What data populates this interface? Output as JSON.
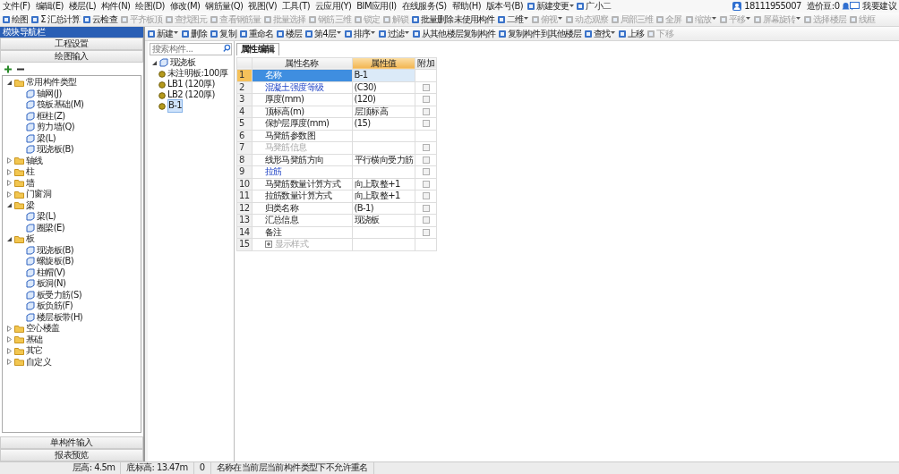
{
  "menu_bar": {
    "items": [
      "文件(F)",
      "编辑(E)",
      "楼层(L)",
      "构件(N)",
      "绘图(D)",
      "修改(M)",
      "钢筋量(Q)",
      "视图(V)",
      "工具(T)",
      "云应用(Y)",
      "BIM应用(I)",
      "在线服务(S)",
      "帮助(H)",
      "版本号(B)"
    ],
    "extras": [
      {
        "label": "新建变更",
        "dropdown": true
      },
      {
        "label": "广小二",
        "dropdown": false
      }
    ],
    "account": "18111955007",
    "beans": "造价豆:0",
    "feedback": "我要建议"
  },
  "main_toolbar": [
    {
      "label": "绘图",
      "disabled": false,
      "dropdown": false
    },
    {
      "label": "Σ 汇总计算",
      "disabled": false,
      "dropdown": false
    },
    {
      "label": "云检查",
      "disabled": false,
      "dropdown": false
    },
    {
      "label": "平齐板顶",
      "disabled": true,
      "dropdown": false
    },
    {
      "label": "查找图元",
      "disabled": true,
      "dropdown": false
    },
    {
      "label": "查看钢筋量",
      "disabled": true,
      "dropdown": false
    },
    {
      "label": "批量选择",
      "disabled": true,
      "dropdown": false
    },
    {
      "label": "钢筋三维",
      "disabled": true,
      "dropdown": false
    },
    {
      "label": "锁定",
      "disabled": true,
      "dropdown": false
    },
    {
      "label": "解锁",
      "disabled": true,
      "dropdown": false
    },
    {
      "label": "批量删除未使用构件",
      "disabled": false,
      "dropdown": false
    },
    {
      "label": "二维",
      "disabled": false,
      "dropdown": true
    },
    {
      "label": "俯视",
      "disabled": true,
      "dropdown": true
    },
    {
      "label": "动态观察",
      "disabled": true,
      "dropdown": false
    },
    {
      "label": "局部三维",
      "disabled": true,
      "dropdown": false
    },
    {
      "label": "全屏",
      "disabled": true,
      "dropdown": false
    },
    {
      "label": "缩放",
      "disabled": true,
      "dropdown": true
    },
    {
      "label": "平移",
      "disabled": true,
      "dropdown": true
    },
    {
      "label": "屏幕旋转",
      "disabled": true,
      "dropdown": true
    },
    {
      "label": "选择楼层",
      "disabled": true,
      "dropdown": false
    },
    {
      "label": "线框",
      "disabled": true,
      "dropdown": false
    }
  ],
  "navigator": {
    "title": "模块导航栏",
    "sections": [
      "工程设置",
      "绘图输入"
    ],
    "tree": [
      {
        "label": "常用构件类型",
        "expanded": true,
        "children": [
          {
            "label": "轴网(J)"
          },
          {
            "label": "筏板基础(M)"
          },
          {
            "label": "框柱(Z)"
          },
          {
            "label": "剪力墙(Q)"
          },
          {
            "label": "梁(L)"
          },
          {
            "label": "现浇板(B)"
          }
        ]
      },
      {
        "label": "轴线",
        "expanded": false
      },
      {
        "label": "柱",
        "expanded": false
      },
      {
        "label": "墙",
        "expanded": false
      },
      {
        "label": "门窗洞",
        "expanded": false
      },
      {
        "label": "梁",
        "expanded": true,
        "children": [
          {
            "label": "梁(L)"
          },
          {
            "label": "圈梁(E)"
          }
        ]
      },
      {
        "label": "板",
        "expanded": true,
        "children": [
          {
            "label": "现浇板(B)"
          },
          {
            "label": "螺旋板(B)"
          },
          {
            "label": "柱帽(V)"
          },
          {
            "label": "板洞(N)"
          },
          {
            "label": "板受力筋(S)"
          },
          {
            "label": "板负筋(F)"
          },
          {
            "label": "楼层板带(H)"
          }
        ]
      },
      {
        "label": "空心楼盖",
        "expanded": false
      },
      {
        "label": "基础",
        "expanded": false
      },
      {
        "label": "其它",
        "expanded": false
      },
      {
        "label": "自定义",
        "expanded": false
      }
    ],
    "bottom_sections": [
      "单构件输入",
      "报表预览"
    ]
  },
  "component_toolbar": [
    {
      "label": "新建",
      "disabled": false,
      "dropdown": true
    },
    {
      "label": "删除",
      "disabled": false,
      "dropdown": false
    },
    {
      "label": "复制",
      "disabled": false,
      "dropdown": false
    },
    {
      "label": "重命名",
      "disabled": false,
      "dropdown": false
    },
    {
      "label": "楼层",
      "disabled": false,
      "dropdown": false
    },
    {
      "label": "第4层",
      "disabled": false,
      "dropdown": true
    },
    {
      "label": "排序",
      "disabled": false,
      "dropdown": true
    },
    {
      "label": "过滤",
      "disabled": false,
      "dropdown": true
    },
    {
      "label": "从其他楼层复制构件",
      "disabled": false,
      "dropdown": false
    },
    {
      "label": "复制构件到其他楼层",
      "disabled": false,
      "dropdown": false
    },
    {
      "label": "查找",
      "disabled": false,
      "dropdown": true
    },
    {
      "label": "上移",
      "disabled": false,
      "dropdown": false
    },
    {
      "label": "下移",
      "disabled": true,
      "dropdown": false
    }
  ],
  "component_list": {
    "search": {
      "placeholder": "搜索构件..."
    },
    "group": "现浇板",
    "items": [
      {
        "label": "未注明板:100厚",
        "selected": false
      },
      {
        "label": "LB1 (120厚)",
        "selected": false
      },
      {
        "label": "LB2 (120厚)",
        "selected": false
      },
      {
        "label": "B-1",
        "selected": true
      }
    ]
  },
  "properties": {
    "tab": "属性编辑",
    "columns": [
      "属性名称",
      "属性值",
      "附加"
    ],
    "rows": [
      {
        "index": "1",
        "name": "名称",
        "value": "B-1",
        "public": true,
        "disabled": false,
        "kind": "plain",
        "selected": true
      },
      {
        "index": "2",
        "name": "混凝土强度等级",
        "value": "(C30)",
        "public": true,
        "disabled": false,
        "kind": "check",
        "checked": false,
        "selected": false
      },
      {
        "index": "3",
        "name": "厚度(mm)",
        "value": "(120)",
        "public": false,
        "disabled": false,
        "kind": "check",
        "checked": false,
        "selected": false
      },
      {
        "index": "4",
        "name": "顶标高(m)",
        "value": "层顶标高",
        "public": false,
        "disabled": false,
        "kind": "check",
        "checked": false,
        "selected": false
      },
      {
        "index": "5",
        "name": "保护层厚度(mm)",
        "value": "(15)",
        "public": false,
        "disabled": false,
        "kind": "check",
        "checked": false,
        "selected": false
      },
      {
        "index": "6",
        "name": "马凳筋参数图",
        "public": false,
        "disabled": false,
        "kind": "plain",
        "selected": false
      },
      {
        "index": "7",
        "name": "马凳筋信息",
        "public": false,
        "disabled": true,
        "kind": "check",
        "checked": false,
        "selected": false
      },
      {
        "index": "8",
        "name": "线形马凳筋方向",
        "value": "平行横向受力筋",
        "public": false,
        "disabled": false,
        "kind": "check",
        "checked": false,
        "selected": false
      },
      {
        "index": "9",
        "name": "拉筋",
        "public": true,
        "disabled": false,
        "kind": "check",
        "checked": false,
        "selected": false
      },
      {
        "index": "10",
        "name": "马凳筋数量计算方式",
        "value": "向上取整+1",
        "public": false,
        "disabled": false,
        "kind": "check",
        "checked": false,
        "selected": false
      },
      {
        "index": "11",
        "name": "拉筋数量计算方式",
        "value": "向上取整+1",
        "public": false,
        "disabled": false,
        "kind": "check",
        "checked": false,
        "selected": false
      },
      {
        "index": "12",
        "name": "归类名称",
        "value": "(B-1)",
        "public": false,
        "disabled": false,
        "kind": "check",
        "checked": false,
        "selected": false
      },
      {
        "index": "13",
        "name": "汇总信息",
        "value": "现浇板",
        "public": false,
        "disabled": false,
        "kind": "check",
        "checked": false,
        "selected": false
      },
      {
        "index": "14",
        "name": "备注",
        "public": false,
        "disabled": false,
        "kind": "check",
        "checked": false,
        "selected": false
      },
      {
        "index": "15",
        "name": "显示样式",
        "public": false,
        "disabled": true,
        "kind": "group",
        "expanded": false,
        "selected": false
      }
    ]
  },
  "status_bar": [
    "层高: 4.5m",
    "底标高: 13.47m",
    "0",
    "名称在当前层当前构件类型下不允许重名"
  ]
}
